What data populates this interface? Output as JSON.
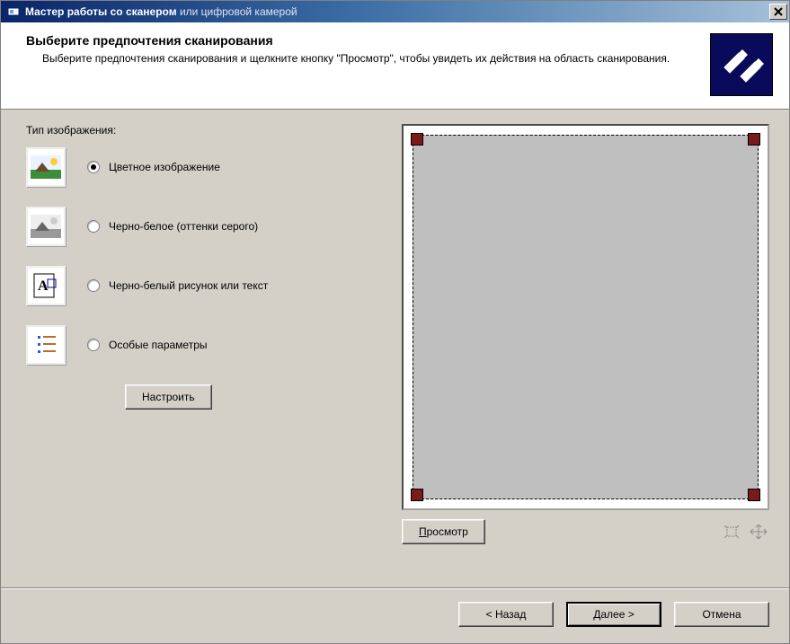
{
  "window": {
    "title_strong": "Мастер работы со сканером",
    "title_rest": " или цифровой камерой"
  },
  "header": {
    "title": "Выберите предпочтения сканирования",
    "description": "Выберите предпочтения сканирования и щелкните кнопку \"Просмотр\", чтобы увидеть их действия на область сканирования."
  },
  "left": {
    "section_label": "Тип изображения:",
    "options": [
      {
        "label": "Цветное изображение",
        "checked": true,
        "icon": "color-photo-icon"
      },
      {
        "label": "Черно-белое (оттенки серого)",
        "checked": false,
        "icon": "grayscale-photo-icon"
      },
      {
        "label": "Черно-белый рисунок или текст",
        "checked": false,
        "icon": "bw-text-icon"
      },
      {
        "label": "Особые параметры",
        "checked": false,
        "icon": "custom-settings-icon"
      }
    ],
    "configure_button": "Настроить"
  },
  "right": {
    "preview_button": "Просмотр"
  },
  "footer": {
    "back": "< Назад",
    "next": "Далее >",
    "cancel": "Отмена"
  }
}
